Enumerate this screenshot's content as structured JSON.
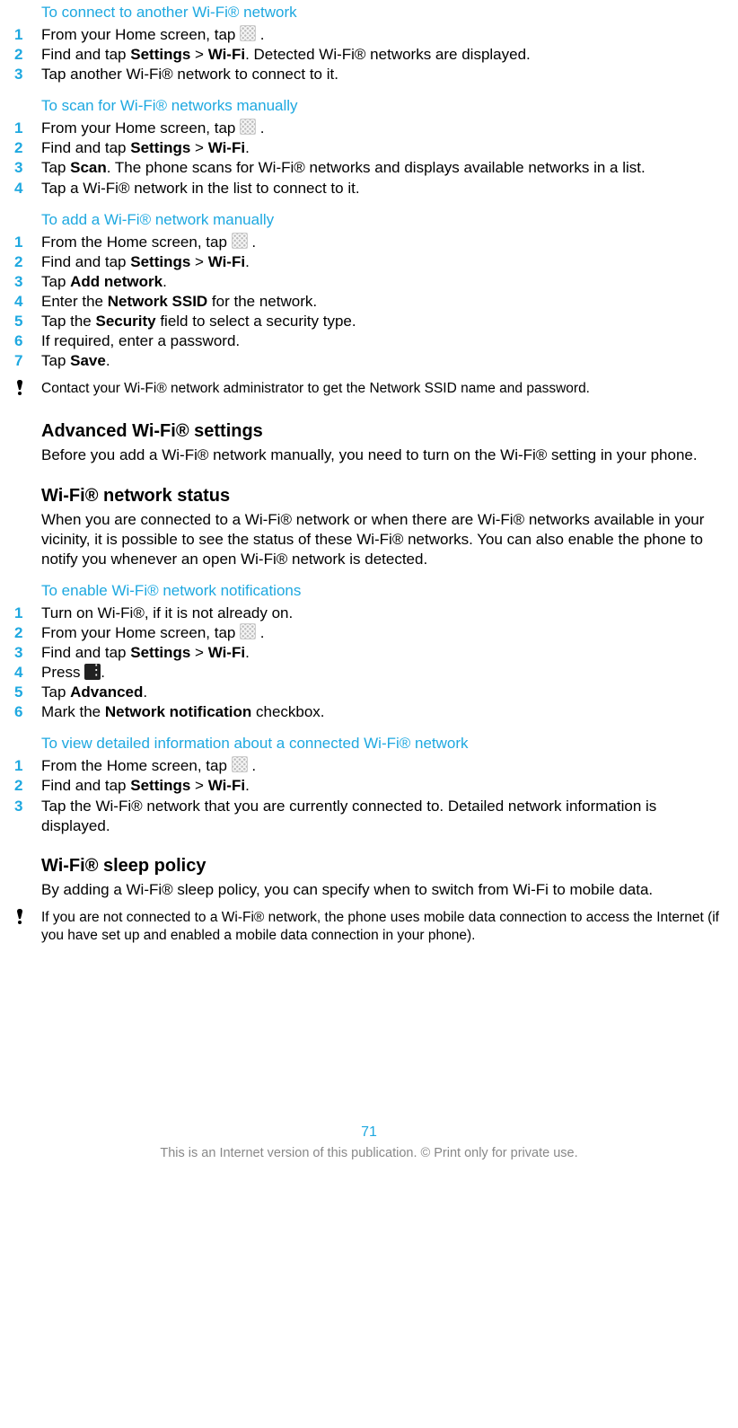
{
  "s1": {
    "title": "To connect to another Wi-Fi® network",
    "steps": [
      {
        "pre": "From your Home screen, tap ",
        "icon": "app-grid",
        "post": " ."
      },
      {
        "pre": "Find and tap ",
        "b1": "Settings",
        "mid": " > ",
        "b2": "Wi-Fi",
        "post": ". Detected Wi-Fi® networks are displayed."
      },
      {
        "pre": "Tap another Wi-Fi® network to connect to it."
      }
    ]
  },
  "s2": {
    "title": "To scan for Wi-Fi® networks manually",
    "steps": [
      {
        "pre": "From your Home screen, tap ",
        "icon": "app-grid",
        "post": " ."
      },
      {
        "pre": "Find and tap ",
        "b1": "Settings",
        "mid": " > ",
        "b2": "Wi-Fi",
        "post": "."
      },
      {
        "pre": "Tap ",
        "b1": "Scan",
        "post": ". The phone scans for Wi-Fi® networks and displays available networks in a list."
      },
      {
        "pre": "Tap a Wi-Fi® network in the list to connect to it."
      }
    ]
  },
  "s3": {
    "title": "To add a Wi-Fi® network manually",
    "steps": [
      {
        "pre": "From the Home screen, tap ",
        "icon": "app-grid",
        "post": " ."
      },
      {
        "pre": "Find and tap ",
        "b1": "Settings",
        "mid": " > ",
        "b2": "Wi-Fi",
        "post": "."
      },
      {
        "pre": "Tap ",
        "b1": "Add network",
        "post": "."
      },
      {
        "pre": "Enter the ",
        "b1": "Network SSID",
        "post": " for the network."
      },
      {
        "pre": "Tap the ",
        "b1": "Security",
        "post": " field to select a security type."
      },
      {
        "pre": "If required, enter a password."
      },
      {
        "pre": "Tap ",
        "b1": "Save",
        "post": "."
      }
    ],
    "note": "Contact your Wi-Fi® network administrator to get the Network SSID name and password."
  },
  "h1": {
    "title": "Advanced Wi-Fi® settings",
    "body": "Before you add a Wi-Fi® network manually, you need to turn on the Wi-Fi® setting in your phone."
  },
  "h2": {
    "title": "Wi-Fi® network status",
    "body": "When you are connected to a Wi-Fi® network or when there are Wi-Fi® networks available in your vicinity, it is possible to see the status of these Wi-Fi® networks. You can also enable the phone to notify you whenever an open Wi-Fi® network is detected."
  },
  "s4": {
    "title": "To enable Wi-Fi® network notifications",
    "steps": [
      {
        "pre": "Turn on Wi-Fi®, if it is not already on."
      },
      {
        "pre": "From your Home screen, tap ",
        "icon": "app-grid",
        "post": " ."
      },
      {
        "pre": "Find and tap ",
        "b1": "Settings",
        "mid": " > ",
        "b2": "Wi-Fi",
        "post": "."
      },
      {
        "pre": "Press ",
        "icon": "menu",
        "post": "."
      },
      {
        "pre": "Tap ",
        "b1": "Advanced",
        "post": "."
      },
      {
        "pre": "Mark the ",
        "b1": "Network notification",
        "post": " checkbox."
      }
    ]
  },
  "s5": {
    "title": "To view detailed information about a connected Wi-Fi® network",
    "steps": [
      {
        "pre": "From the Home screen, tap ",
        "icon": "app-grid",
        "post": " ."
      },
      {
        "pre": "Find and tap ",
        "b1": "Settings",
        "mid": " > ",
        "b2": "Wi-Fi",
        "post": "."
      },
      {
        "pre": "Tap the Wi-Fi® network that you are currently connected to. Detailed network information is displayed."
      }
    ]
  },
  "h3": {
    "title": "Wi-Fi® sleep policy",
    "body": "By adding a Wi-Fi® sleep policy, you can specify when to switch from Wi-Fi to mobile data.",
    "note": "If you are not connected to a Wi-Fi® network, the phone uses mobile data connection to access the Internet (if you have set up and enabled a mobile data connection in your phone)."
  },
  "pageno": "71",
  "copyright": "This is an Internet version of this publication. © Print only for private use."
}
